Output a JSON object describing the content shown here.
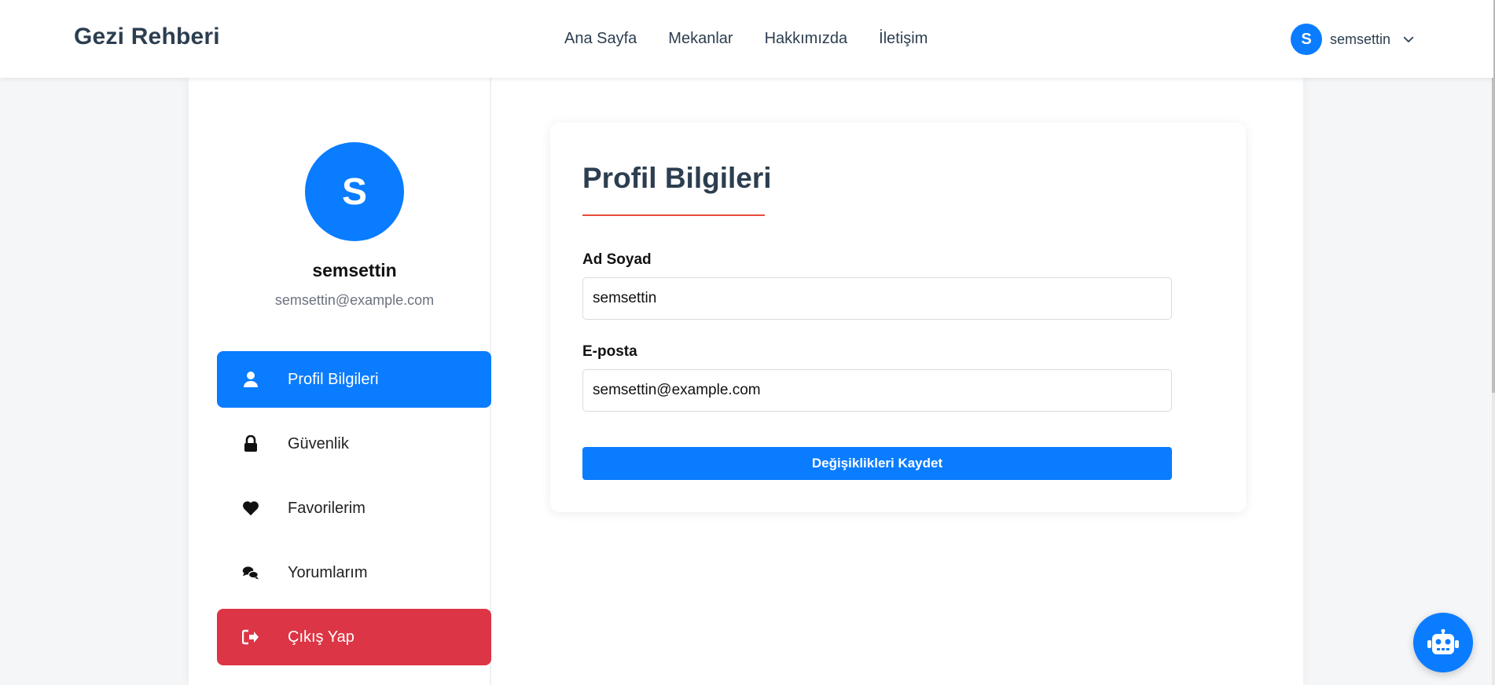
{
  "header": {
    "brand": "Gezi Rehberi",
    "nav": [
      "Ana Sayfa",
      "Mekanlar",
      "Hakkımızda",
      "İletişim"
    ],
    "user": {
      "initial": "S",
      "name": "semsettin"
    }
  },
  "sidebar": {
    "avatar_initial": "S",
    "name": "semsettin",
    "email": "semsettin@example.com",
    "items": [
      {
        "label": "Profil Bilgileri",
        "icon": "user-icon",
        "state": "active"
      },
      {
        "label": "Güvenlik",
        "icon": "lock-icon",
        "state": "normal"
      },
      {
        "label": "Favorilerim",
        "icon": "heart-icon",
        "state": "normal"
      },
      {
        "label": "Yorumlarım",
        "icon": "comments-icon",
        "state": "normal"
      },
      {
        "label": "Çıkış Yap",
        "icon": "sign-out-icon",
        "state": "danger"
      }
    ]
  },
  "main": {
    "title": "Profil Bilgileri",
    "fields": [
      {
        "label": "Ad Soyad",
        "value": "semsettin"
      },
      {
        "label": "E-posta",
        "value": "semsettin@example.com"
      }
    ],
    "save_label": "Değişiklikleri Kaydet"
  },
  "chatbot": {
    "icon": "robot-icon"
  },
  "colors": {
    "primary": "#0a7cff",
    "danger": "#dc3545",
    "accent_underline": "#e74c3c",
    "heading": "#2c3e50"
  }
}
